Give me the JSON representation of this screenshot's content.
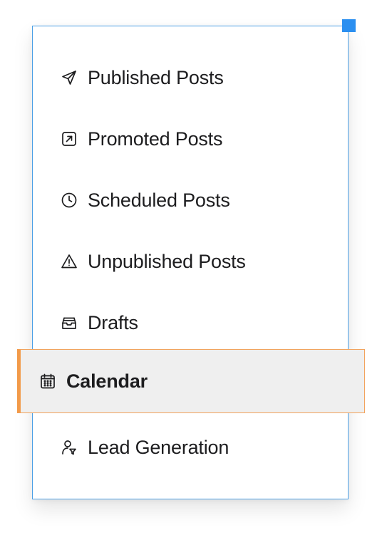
{
  "menu": {
    "items": [
      {
        "label": "Published Posts",
        "icon": "paper-plane-icon"
      },
      {
        "label": "Promoted Posts",
        "icon": "arrow-up-right-square-icon"
      },
      {
        "label": "Scheduled Posts",
        "icon": "clock-icon"
      },
      {
        "label": "Unpublished Posts",
        "icon": "warning-triangle-icon"
      },
      {
        "label": "Drafts",
        "icon": "inbox-tray-icon"
      },
      {
        "label": "Calendar",
        "icon": "calendar-icon",
        "active": true
      },
      {
        "label": "Lead Generation",
        "icon": "user-funnel-icon"
      }
    ]
  },
  "colors": {
    "panel_border": "#4a9fe6",
    "resize_handle": "#2b8ff0",
    "active_background": "#efefef",
    "active_border": "#f29a49"
  }
}
